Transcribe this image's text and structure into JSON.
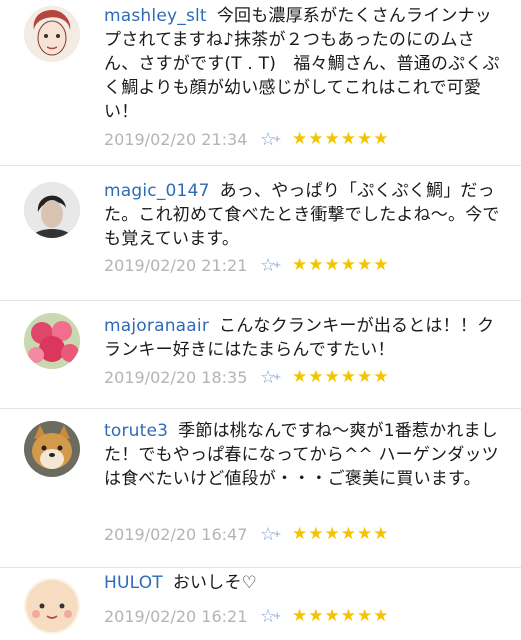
{
  "comments": [
    {
      "user": "mashley_slt",
      "text": "今回も濃厚系がたくさんラインナップされてますね♪抹茶が２つもあったのにのムさん、さすがです(T . T)　福々鯛さん、普通のぷくぷく鯛よりも顔が幼い感じがしてこれはこれで可愛い！",
      "date": "2019/02/20 21:34",
      "stars": "★★★★★★",
      "avatar": "drawing-face"
    },
    {
      "user": "magic_0147",
      "text": "あっ、やっぱり「ぷくぷく鯛」だった。これ初めて食べたとき衝撃でしたよね〜。今でも覚えています。",
      "date": "2019/02/20 21:21",
      "stars": "★★★★★★",
      "avatar": "person-photo"
    },
    {
      "user": "majoranaair",
      "text": "こんなクランキーが出るとは！！クランキー好きにはたまらんですたい！",
      "date": "2019/02/20 18:35",
      "stars": "★★★★★★",
      "avatar": "flower-photo"
    },
    {
      "user": "torute3",
      "text": "季節は桃なんですね〜爽が1番惹かれました！でもやっぱ春になってから^^ ハーゲンダッツは食べたいけど値段が・・・ご褒美に買います。",
      "date": "2019/02/20 16:47",
      "stars": "★★★★★★",
      "avatar": "dog-photo"
    },
    {
      "user": "HULOT",
      "text": "おいしそ♡",
      "date": "2019/02/20 16:21",
      "stars": "★★★★★★",
      "avatar": "smiley-face"
    }
  ],
  "icons": {
    "fav": "add-favorite-icon",
    "star_color": "#f5c400",
    "username_color": "#2e6bb8"
  }
}
